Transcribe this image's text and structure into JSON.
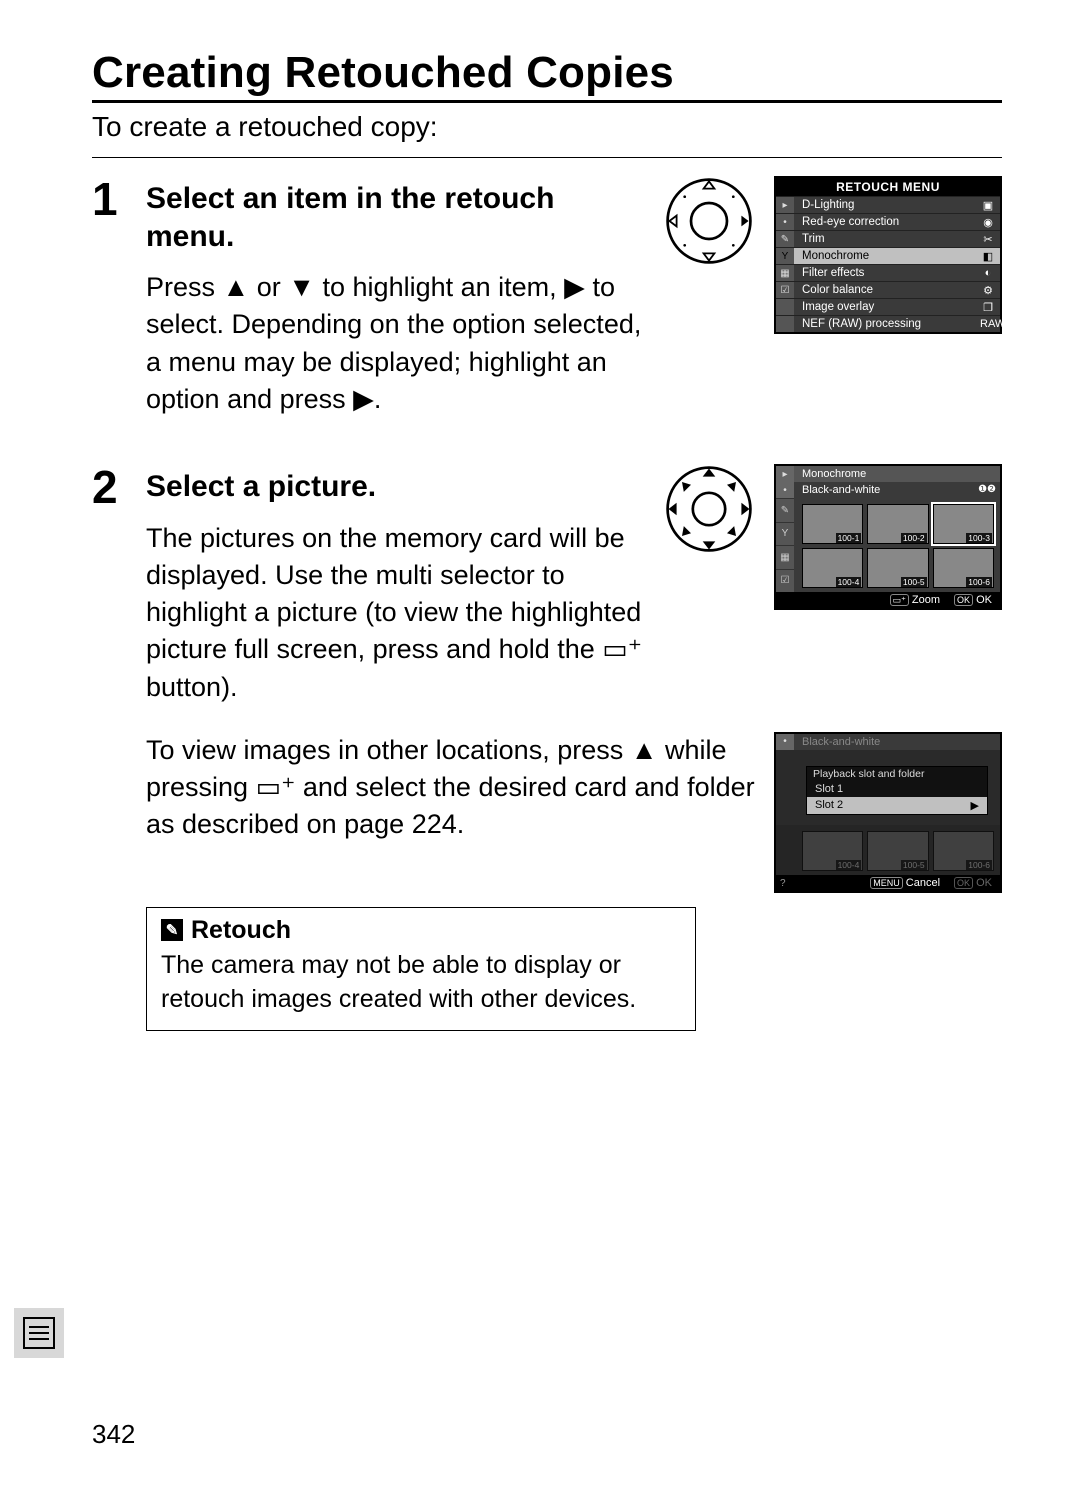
{
  "page": {
    "title": "Creating Retouched Copies",
    "intro": "To create a retouched copy:",
    "number": "342"
  },
  "steps": [
    {
      "num": "1",
      "heading": "Select an item in the retouch menu.",
      "body1_a": "Press ",
      "body1_b": " or ",
      "body1_c": " to highlight an item, ",
      "body1_d": " to select.  Depending on the option selected, a menu may be displayed; highlight an option and press ",
      "body1_e": "."
    },
    {
      "num": "2",
      "heading": "Select a picture.",
      "body1": "The pictures on the memory card will be displayed.  Use the multi selector to highlight a picture (to view the highlighted picture full screen, press and hold the ",
      "body1_end": " button).",
      "body2_a": "To view images in other locations, press ",
      "body2_b": " while pressing ",
      "body2_c": " and select the desired card and folder as described on page 224."
    }
  ],
  "note": {
    "title": "Retouch",
    "body": "The camera may not be able to display or retouch images created with other devices."
  },
  "lcd1": {
    "title": "RETOUCH MENU",
    "tabs": [
      "▸",
      "•",
      "✎",
      "Y",
      "▦",
      "☑"
    ],
    "items": [
      {
        "label": "D-Lighting",
        "icon": "▣"
      },
      {
        "label": "Red-eye correction",
        "icon": "◉"
      },
      {
        "label": "Trim",
        "icon": "✂"
      },
      {
        "label": "Monochrome",
        "icon": "◧",
        "selected": true
      },
      {
        "label": "Filter effects",
        "icon": "◐"
      },
      {
        "label": "Color balance",
        "icon": "⚙"
      },
      {
        "label": "Image overlay",
        "icon": "❐"
      },
      {
        "label": "NEF (RAW) processing",
        "icon": "RAW"
      }
    ]
  },
  "lcd2": {
    "header1": "Monochrome",
    "header2": "Black-and-white",
    "thumbs": [
      "100-1",
      "100-2",
      "100-3",
      "100-4",
      "100-5",
      "100-6"
    ],
    "selected": 2,
    "footer_zoom": "Zoom",
    "footer_ok": "OK"
  },
  "lcd3": {
    "popup_title": "Playback slot and folder",
    "header2": "Black-and-white",
    "slots": [
      "Slot 1",
      "Slot 2"
    ],
    "selected": 1,
    "thumbs": [
      "100-4",
      "100-5",
      "100-6"
    ],
    "footer_cancel": "Cancel",
    "footer_ok": "OK"
  }
}
